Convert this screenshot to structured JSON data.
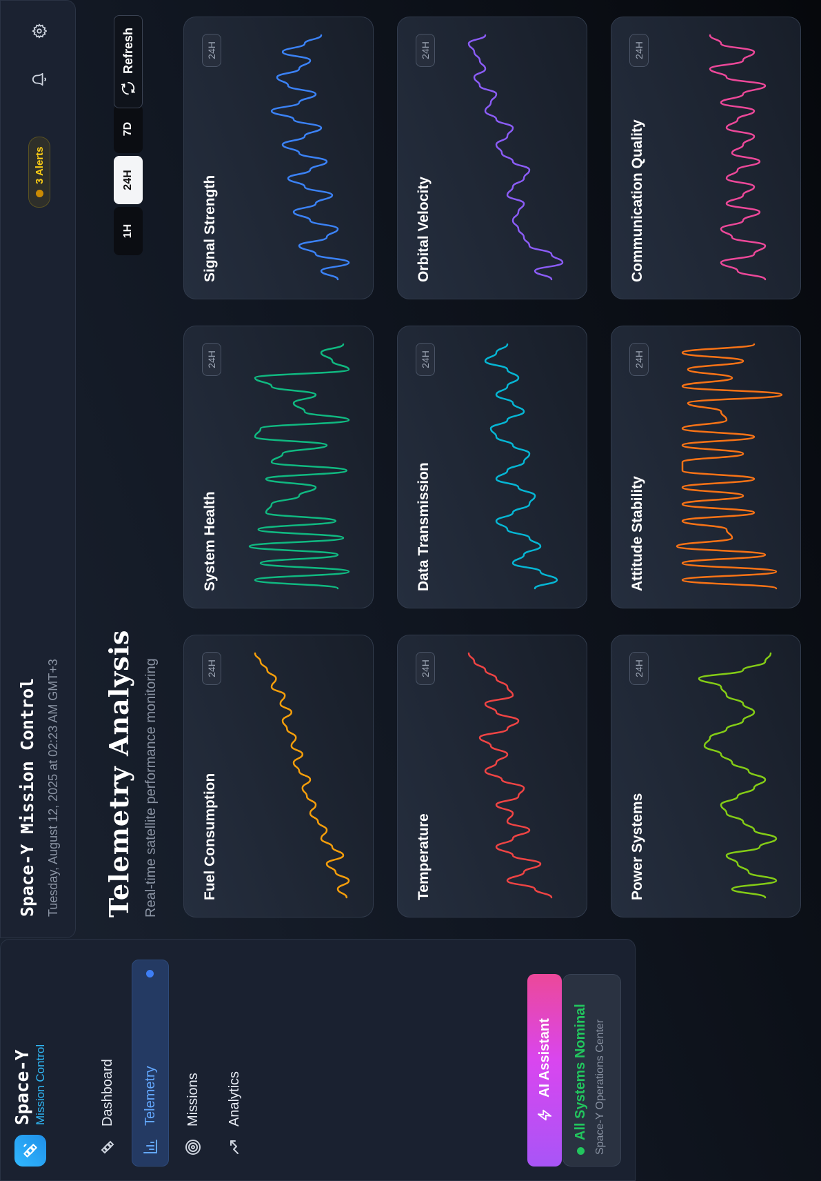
{
  "sidebar": {
    "brand_name": "Space-Y",
    "brand_sub": "Mission Control",
    "nav": [
      {
        "label": "Dashboard"
      },
      {
        "label": "Telemetry"
      },
      {
        "label": "Missions"
      },
      {
        "label": "Analytics"
      }
    ],
    "ai_assistant_label": "AI Assistant",
    "status_text": "All Systems Nominal",
    "status_sub": "Space-Y Operations Center"
  },
  "header": {
    "title": "Space-Y Mission Control",
    "date": "Tuesday, August 12, 2025 at 02:23 AM GMT+3",
    "alerts": "3 Alerts"
  },
  "page": {
    "title": "Telemetry Analysis",
    "subtitle": "Real-time satellite performance monitoring",
    "ranges": [
      "1H",
      "24H",
      "7D"
    ],
    "selected_range": "24H",
    "refresh_label": "Refresh"
  },
  "colors": {
    "accent": "#3e7ef5",
    "ai_gradient_start": "#a855f7",
    "ai_gradient_end": "#ec4899",
    "status_green": "#22c55e",
    "alert_yellow": "#facc15"
  },
  "cards": [
    {
      "title": "Fuel Consumption",
      "badge": "24H",
      "color": "#f59e0b",
      "values": [
        0.12,
        0.2,
        0.1,
        0.22,
        0.3,
        0.15,
        0.25,
        0.35,
        0.3,
        0.38,
        0.45,
        0.4,
        0.48,
        0.52,
        0.45,
        0.55,
        0.6,
        0.52,
        0.62,
        0.58,
        0.66,
        0.7,
        0.62,
        0.72,
        0.68,
        0.8,
        0.76,
        0.84,
        0.9,
        0.95
      ]
    },
    {
      "title": "System Health",
      "badge": "24H",
      "color": "#10b981",
      "values": [
        0.2,
        0.95,
        0.1,
        0.9,
        0.2,
        1.0,
        0.15,
        0.92,
        0.22,
        0.85,
        0.8,
        0.55,
        0.4,
        0.85,
        0.12,
        0.8,
        0.7,
        0.3,
        0.95,
        0.9,
        0.1,
        0.5,
        0.6,
        0.4,
        0.8,
        0.95,
        0.1,
        0.25,
        0.35,
        0.15
      ]
    },
    {
      "title": "Signal Strength",
      "badge": "24H",
      "color": "#3b82f6",
      "values": [
        0.2,
        0.35,
        0.1,
        0.4,
        0.55,
        0.3,
        0.2,
        0.45,
        0.6,
        0.4,
        0.25,
        0.5,
        0.65,
        0.45,
        0.3,
        0.55,
        0.7,
        0.5,
        0.35,
        0.6,
        0.8,
        0.55,
        0.4,
        0.65,
        0.75,
        0.55,
        0.45,
        0.7,
        0.5,
        0.35
      ]
    },
    {
      "title": "Temperature",
      "badge": "24H",
      "color": "#ef4444",
      "values": [
        0.2,
        0.35,
        0.6,
        0.45,
        0.3,
        0.55,
        0.7,
        0.55,
        0.4,
        0.6,
        0.55,
        0.7,
        0.5,
        0.45,
        0.65,
        0.8,
        0.7,
        0.6,
        0.75,
        0.85,
        0.6,
        0.5,
        0.7,
        0.8,
        0.55,
        0.6,
        0.7,
        0.8,
        0.9,
        0.95
      ]
    },
    {
      "title": "Data Transmission",
      "badge": "24H",
      "color": "#06b6d4",
      "values": [
        0.35,
        0.15,
        0.3,
        0.55,
        0.45,
        0.3,
        0.4,
        0.6,
        0.7,
        0.55,
        0.4,
        0.35,
        0.5,
        0.7,
        0.6,
        0.45,
        0.4,
        0.55,
        0.7,
        0.75,
        0.6,
        0.45,
        0.55,
        0.7,
        0.6,
        0.5,
        0.6,
        0.8,
        0.7,
        0.6
      ]
    },
    {
      "title": "Orbital Velocity",
      "badge": "24H",
      "color": "#8b5cf6",
      "values": [
        0.2,
        0.35,
        0.1,
        0.2,
        0.4,
        0.45,
        0.5,
        0.55,
        0.5,
        0.45,
        0.6,
        0.55,
        0.45,
        0.4,
        0.55,
        0.65,
        0.7,
        0.6,
        0.55,
        0.7,
        0.8,
        0.75,
        0.7,
        0.85,
        0.9,
        0.8,
        0.85,
        0.9,
        0.95,
        0.8
      ]
    },
    {
      "title": "Power Systems",
      "badge": "24H",
      "color": "#84cc16",
      "values": [
        0.2,
        0.5,
        0.1,
        0.35,
        0.45,
        0.55,
        0.25,
        0.1,
        0.3,
        0.4,
        0.55,
        0.6,
        0.45,
        0.3,
        0.2,
        0.35,
        0.5,
        0.6,
        0.75,
        0.7,
        0.55,
        0.4,
        0.3,
        0.4,
        0.55,
        0.6,
        0.8,
        0.4,
        0.2,
        0.15
      ]
    },
    {
      "title": "Attitude Stability",
      "badge": "24H",
      "color": "#f97316",
      "values": [
        0.1,
        0.95,
        0.1,
        0.95,
        0.2,
        1.0,
        0.5,
        0.55,
        0.95,
        0.3,
        0.95,
        0.4,
        0.95,
        0.3,
        0.95,
        0.95,
        0.4,
        0.95,
        0.3,
        0.95,
        0.55,
        0.6,
        0.9,
        0.05,
        0.95,
        0.5,
        0.9,
        0.4,
        0.95,
        0.3
      ]
    },
    {
      "title": "Communication Quality",
      "badge": "24H",
      "color": "#ec4899",
      "values": [
        0.2,
        0.45,
        0.6,
        0.3,
        0.2,
        0.5,
        0.6,
        0.4,
        0.25,
        0.55,
        0.4,
        0.3,
        0.55,
        0.45,
        0.25,
        0.5,
        0.4,
        0.3,
        0.55,
        0.45,
        0.3,
        0.6,
        0.4,
        0.2,
        0.55,
        0.7,
        0.4,
        0.3,
        0.6,
        0.7
      ]
    }
  ]
}
